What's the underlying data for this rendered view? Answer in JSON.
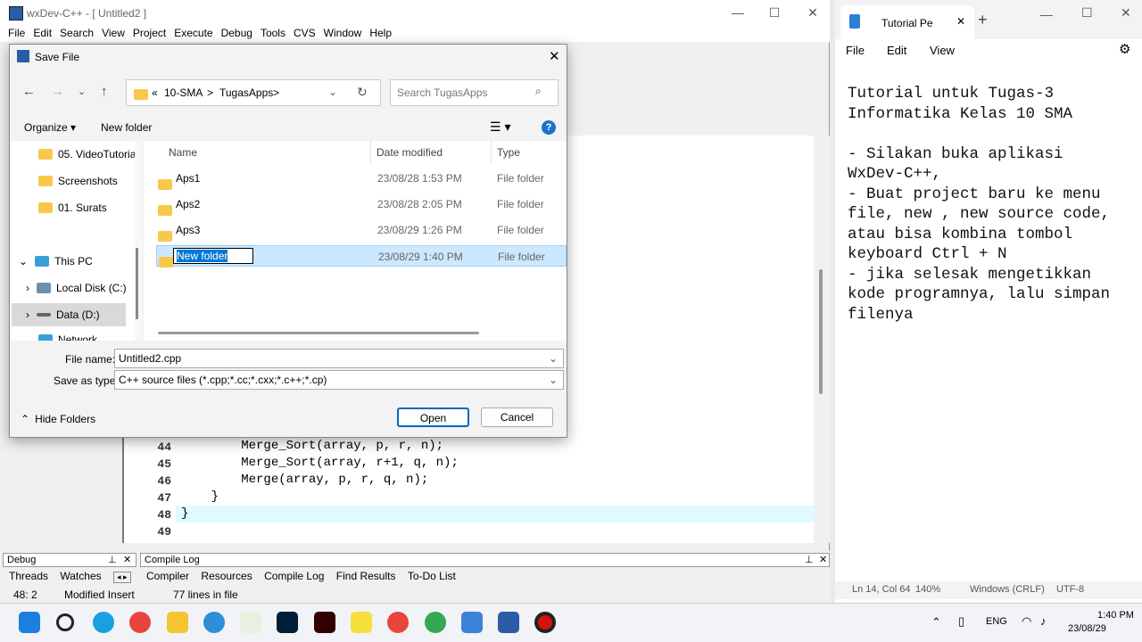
{
  "ide": {
    "title": "wxDev-C++ - [ Untitled2 ]",
    "menu": [
      "File",
      "Edit",
      "Search",
      "View",
      "Project",
      "Execute",
      "Debug",
      "Tools",
      "CVS",
      "Window",
      "Help"
    ],
    "code": [
      {
        "ln": "44",
        "text": "        Merge_Sort(array, p, r, n);"
      },
      {
        "ln": "45",
        "text": "        Merge_Sort(array, r+1, q, n);"
      },
      {
        "ln": "46",
        "text": "        Merge(array, p, r, q, n);"
      },
      {
        "ln": "47",
        "text": "    }"
      },
      {
        "ln": "48",
        "text": "}"
      },
      {
        "ln": "49",
        "text": ""
      }
    ],
    "debug_label": "Debug",
    "compile_log_label": "Compile Log",
    "debug_tabs": [
      "Threads",
      "Watches"
    ],
    "output_tabs": [
      "Compiler",
      "Resources",
      "Compile Log",
      "Find Results",
      "To-Do List"
    ],
    "status": {
      "pos": "48: 2",
      "mode": "Modified Insert",
      "lines": "77 lines in file"
    }
  },
  "dialog": {
    "title": "Save File",
    "breadcrumb": [
      "«",
      "10-SMA",
      ">",
      "TugasApps",
      ">"
    ],
    "search_placeholder": "Search TugasApps",
    "organize": "Organize ▾",
    "new_folder": "New folder",
    "nav": [
      "05. VideoTutoria",
      "Screenshots",
      "01. Surats",
      "This PC",
      "Local Disk (C:)",
      "Data (D:)",
      "Network"
    ],
    "columns": {
      "name": "Name",
      "date": "Date modified",
      "type": "Type"
    },
    "files": [
      {
        "name": "Aps1",
        "date": "23/08/28 1:53 PM",
        "type": "File folder"
      },
      {
        "name": "Aps2",
        "date": "23/08/28 2:05 PM",
        "type": "File folder"
      },
      {
        "name": "Aps3",
        "date": "23/08/29 1:26 PM",
        "type": "File folder"
      },
      {
        "name": "New folder",
        "date": "23/08/29 1:40 PM",
        "type": "File folder"
      }
    ],
    "file_name_label": "File name:",
    "file_name_value": "Untitled2.cpp",
    "save_type_label": "Save as type:",
    "save_type_value": "C++ source files (*.cpp;*.cc;*.cxx;*.c++;*.cp)",
    "hide_folders": "Hide Folders",
    "open": "Open",
    "cancel": "Cancel"
  },
  "notepad": {
    "tab_title": "Tutorial Pe",
    "menu": [
      "File",
      "Edit",
      "View"
    ],
    "text": "Tutorial untuk Tugas-3\nInformatika Kelas 10 SMA\n\n- Silakan buka aplikasi\nWxDev-C++,\n- Buat project baru ke menu\nfile, new , new source code,\natau bisa kombina tombol\nkeyboard Ctrl + N\n- jika selesak mengetikkan\nkode programnya, lalu simpan\nfilenya",
    "status": {
      "pos": "Ln 14, Col 64",
      "zoom": "140%",
      "eol": "Windows (CRLF)",
      "enc": "UTF-8"
    }
  },
  "taskbar": {
    "lang": "ENG",
    "time": "1:40 PM",
    "date": "23/08/29"
  }
}
